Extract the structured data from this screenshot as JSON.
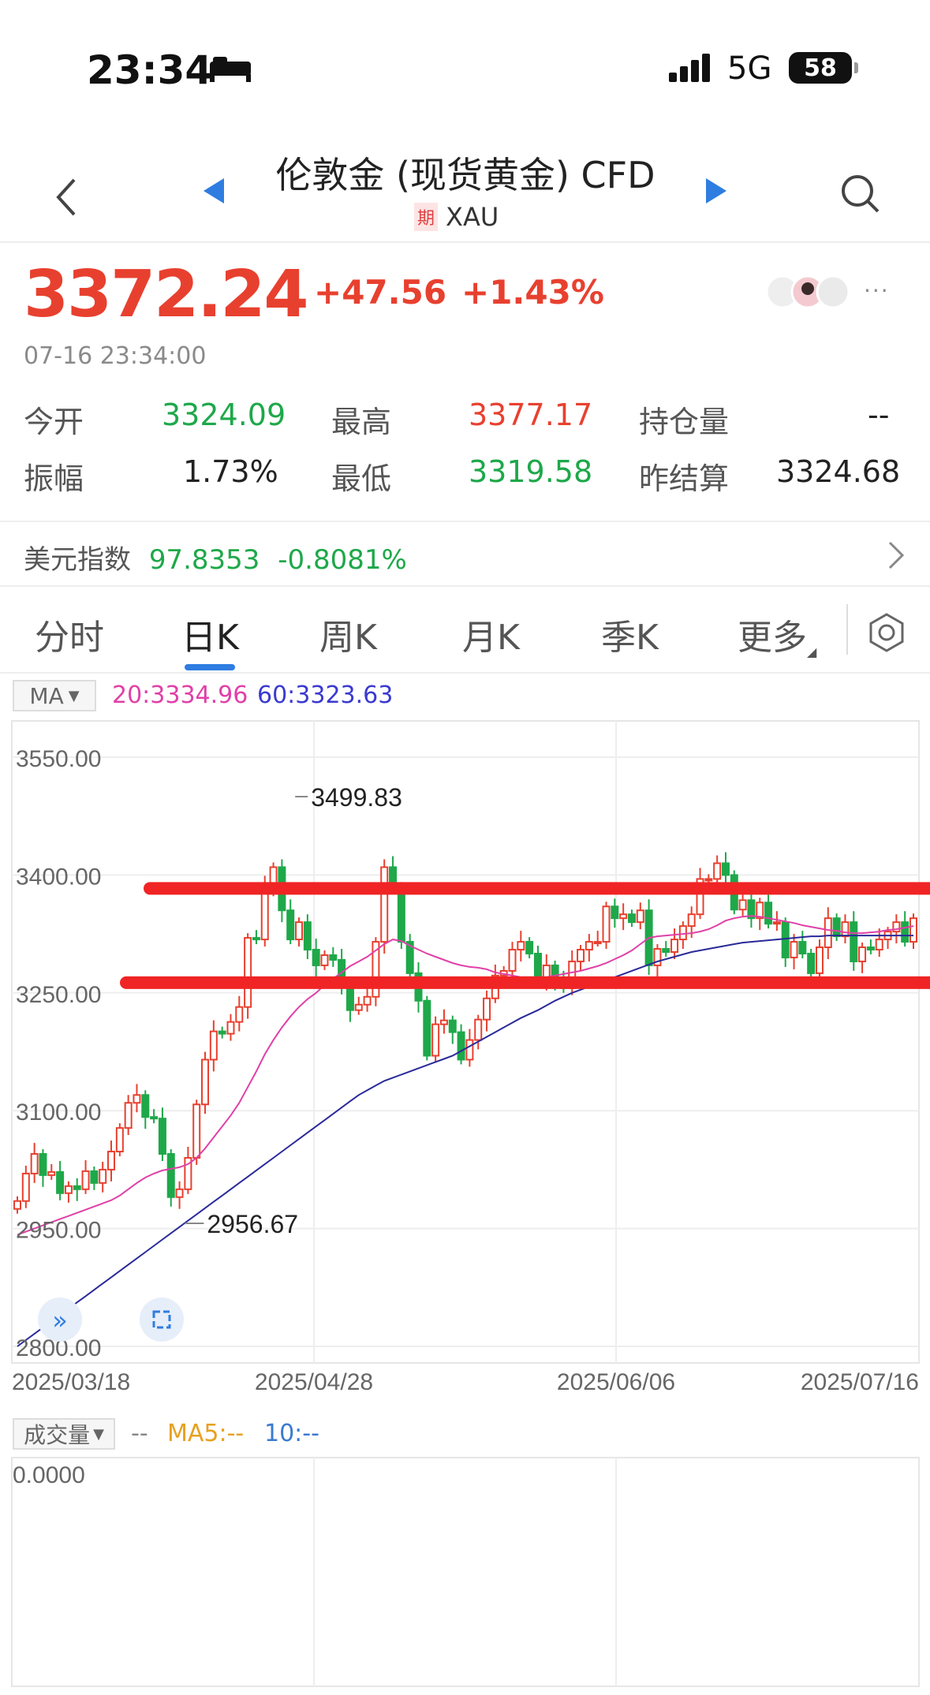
{
  "status": {
    "time": "23:34",
    "network": "5G",
    "battery": "58"
  },
  "nav": {
    "title": "伦敦金 (现货黄金) CFD",
    "badge": "期",
    "symbol": "XAU"
  },
  "quote": {
    "price": "3372.24",
    "change": "+47.56",
    "change_pct": "+1.43%",
    "timestamp": "07-16 23:34:00",
    "stats": [
      {
        "label": "今开",
        "value": "3324.09"
      },
      {
        "label": "最高",
        "value": "3377.17"
      },
      {
        "label": "持仓量",
        "value": "--"
      },
      {
        "label": "振幅",
        "value": "1.73%"
      },
      {
        "label": "最低",
        "value": "3319.58"
      },
      {
        "label": "昨结算",
        "value": "3324.68"
      }
    ],
    "more_label": "···"
  },
  "dollar_index": {
    "label": "美元指数",
    "value": "97.8353",
    "change": "-0.8081%"
  },
  "tabs": [
    {
      "label": "分时"
    },
    {
      "label": "日K"
    },
    {
      "label": "周K"
    },
    {
      "label": "月K"
    },
    {
      "label": "季K"
    },
    {
      "label": "更多"
    }
  ],
  "indicators": {
    "ma_button": "MA",
    "ma20": "20:3334.96",
    "ma60": "60:3323.63"
  },
  "volume": {
    "button": "成交量",
    "value": "--",
    "ma5": "MA5:--",
    "ma10": "10:--",
    "axis_label": "0.0000"
  },
  "colors": {
    "up": "#e8402f",
    "down": "#1ea84a",
    "accent": "#2f7de1",
    "ma20": "#e040a8",
    "ma60": "#2a2a9a"
  },
  "chart_data": {
    "type": "candlestick",
    "y_ticks": [
      "3550.00",
      "3400.00",
      "3250.00",
      "3100.00",
      "2950.00",
      "2800.00"
    ],
    "ylim": [
      2800,
      3550
    ],
    "x_ticks": [
      "2025/03/18",
      "2025/04/28",
      "2025/06/06",
      "2025/07/16"
    ],
    "annotations": {
      "high": "3499.83",
      "low": "2956.67"
    },
    "horizontal_lines": [
      3383,
      3263
    ],
    "closes": [
      2985,
      3020,
      3045,
      3018,
      3022,
      2995,
      3004,
      3000,
      3023,
      3008,
      3025,
      3048,
      3078,
      3110,
      3120,
      3092,
      3090,
      3045,
      2990,
      3000,
      3040,
      3108,
      3165,
      3201,
      3198,
      3213,
      3232,
      3320,
      3318,
      3385,
      3410,
      3355,
      3318,
      3340,
      3305,
      3285,
      3298,
      3292,
      3260,
      3228,
      3235,
      3245,
      3315,
      3410,
      3385,
      3315,
      3275,
      3240,
      3170,
      3210,
      3215,
      3200,
      3165,
      3190,
      3216,
      3243,
      3272,
      3278,
      3305,
      3315,
      3300,
      3265,
      3285,
      3268,
      3256,
      3290,
      3305,
      3315,
      3315,
      3360,
      3345,
      3350,
      3340,
      3355,
      3285,
      3306,
      3302,
      3318,
      3335,
      3350,
      3395,
      3395,
      3415,
      3400,
      3356,
      3368,
      3345,
      3365,
      3338,
      3340,
      3295,
      3315,
      3300,
      3275,
      3308,
      3345,
      3322,
      3340,
      3290,
      3308,
      3305,
      3318,
      3328,
      3340,
      3315,
      3345
    ],
    "ma20": [
      2942,
      2946,
      2950,
      2954,
      2958,
      2962,
      2966,
      2970,
      2974,
      2978,
      2982,
      2986,
      2992,
      3000,
      3008,
      3015,
      3020,
      3024,
      3026,
      3028,
      3032,
      3040,
      3052,
      3066,
      3080,
      3094,
      3110,
      3130,
      3150,
      3172,
      3190,
      3206,
      3220,
      3232,
      3242,
      3250,
      3260,
      3268,
      3276,
      3284,
      3290,
      3296,
      3304,
      3312,
      3318,
      3316,
      3310,
      3305,
      3300,
      3296,
      3292,
      3288,
      3285,
      3283,
      3282,
      3280,
      3276,
      3274,
      3272,
      3270,
      3270,
      3270,
      3270,
      3272,
      3274,
      3276,
      3278,
      3281,
      3284,
      3288,
      3293,
      3298,
      3304,
      3312,
      3320,
      3322,
      3323,
      3324,
      3325,
      3326,
      3328,
      3331,
      3336,
      3342,
      3345,
      3347,
      3348,
      3347,
      3345,
      3343,
      3341,
      3339,
      3336,
      3334,
      3332,
      3330,
      3329,
      3327,
      3326,
      3326,
      3327,
      3328,
      3330,
      3331,
      3333,
      3335
    ],
    "ma60": [
      2800,
      2808,
      2816,
      2824,
      2832,
      2840,
      2848,
      2856,
      2864,
      2872,
      2880,
      2888,
      2896,
      2904,
      2912,
      2920,
      2928,
      2936,
      2944,
      2952,
      2960,
      2968,
      2976,
      2984,
      2992,
      3000,
      3008,
      3016,
      3024,
      3032,
      3040,
      3048,
      3056,
      3064,
      3072,
      3080,
      3088,
      3096,
      3104,
      3112,
      3120,
      3126,
      3132,
      3138,
      3142,
      3146,
      3150,
      3154,
      3158,
      3162,
      3166,
      3170,
      3176,
      3182,
      3188,
      3194,
      3200,
      3206,
      3212,
      3218,
      3223,
      3228,
      3234,
      3240,
      3245,
      3250,
      3254,
      3258,
      3262,
      3266,
      3270,
      3274,
      3278,
      3282,
      3286,
      3290,
      3293,
      3296,
      3299,
      3302,
      3304,
      3306,
      3308,
      3310,
      3312,
      3314,
      3315,
      3316,
      3317,
      3318,
      3319,
      3320,
      3321,
      3322,
      3322,
      3323,
      3323,
      3323,
      3323,
      3323,
      3323,
      3323,
      3323,
      3323,
      3323,
      3323
    ]
  }
}
